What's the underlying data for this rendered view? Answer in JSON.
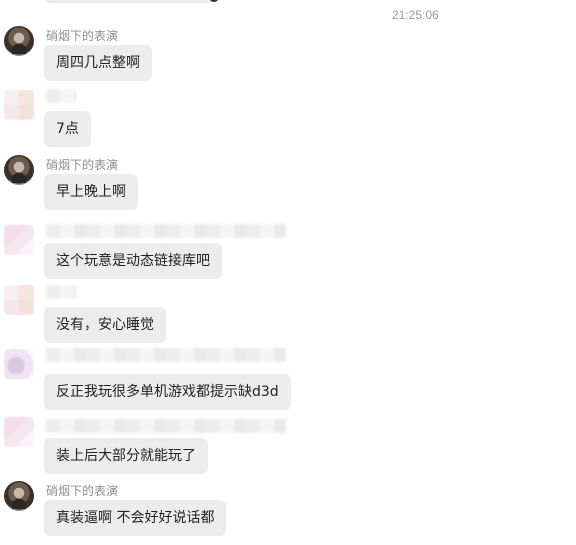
{
  "timestamp": "21:25:06",
  "messages": [
    {
      "sender": "硝烟下的表演",
      "text": "周四几点整啊"
    },
    {
      "sender": "",
      "text": "7点"
    },
    {
      "sender": "硝烟下的表演",
      "text": "早上晚上啊"
    },
    {
      "sender": "",
      "text": "这个玩意是动态链接库吧"
    },
    {
      "sender": "",
      "text": "没有，安心睡觉"
    },
    {
      "sender": "",
      "text": "反正我玩很多单机游戏都提示缺d3d"
    },
    {
      "sender": "",
      "text": "装上后大部分就能玩了"
    },
    {
      "sender": "硝烟下的表演",
      "text": "真装逼啊 不会好好说话都"
    }
  ]
}
